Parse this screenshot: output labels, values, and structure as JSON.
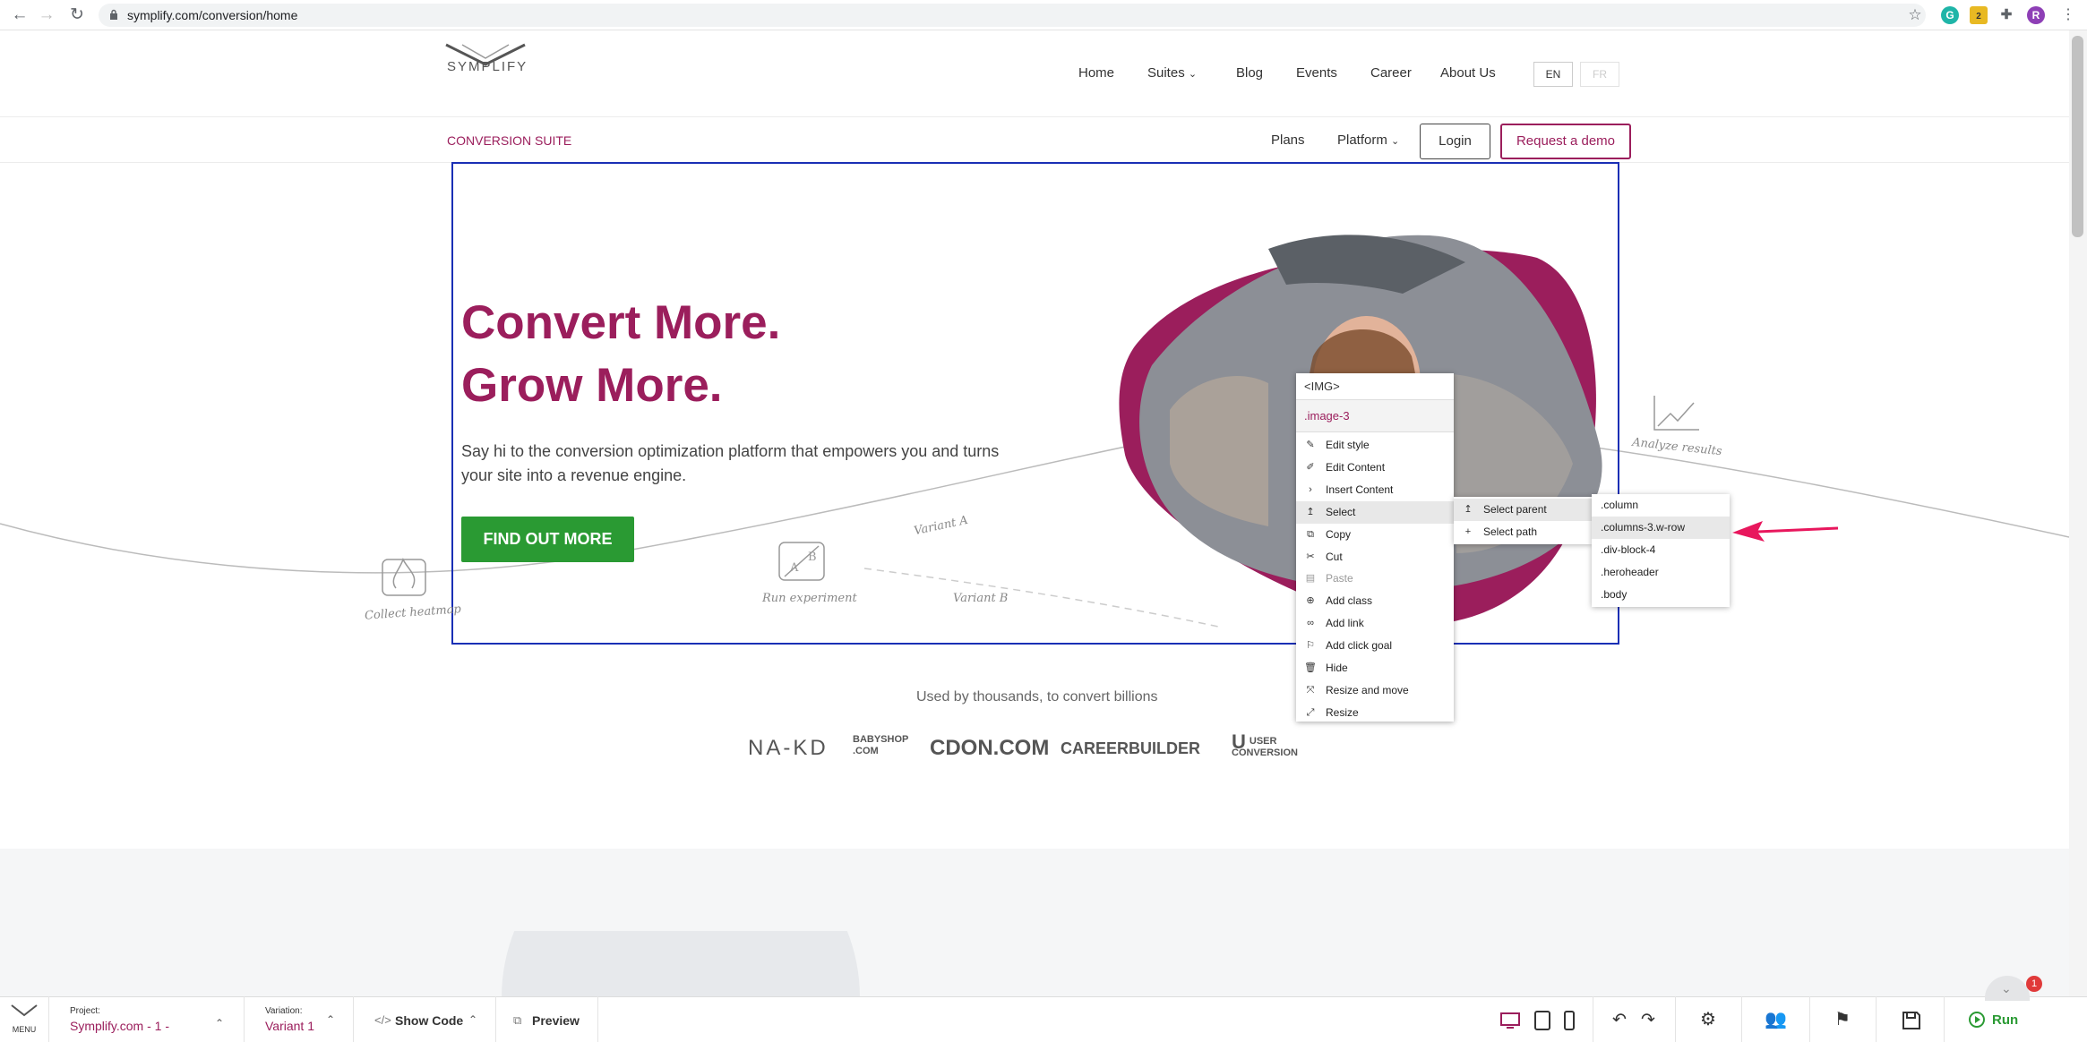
{
  "browser": {
    "url": "symplify.com/conversion/home",
    "avatar_letter": "R",
    "ext_badge": "2"
  },
  "header": {
    "logo": "SYMPLIFY",
    "nav": [
      "Home",
      "Suites",
      "Blog",
      "Events",
      "Career",
      "About Us"
    ],
    "lang_en": "EN",
    "lang_fr": "FR"
  },
  "subheader": {
    "suite": "CONVERSION SUITE",
    "plans": "Plans",
    "platform": "Platform",
    "login": "Login",
    "demo": "Request a demo"
  },
  "hero": {
    "title_line1": "Convert More.",
    "title_line2": "Grow More.",
    "subtitle": "Say hi to the conversion optimization platform that empowers you and turns your site into a revenue engine.",
    "cta": "FIND OUT MORE",
    "sketch_labels": {
      "collect": "Collect heatmap",
      "run": "Run experiment",
      "variant_a": "Variant A",
      "variant_b": "Variant B",
      "analyze": "Analyze results"
    }
  },
  "logos": {
    "heading": "Used by thousands, to convert billions",
    "brands": [
      "NA-KD",
      "BABYSHOP .COM",
      "CDON.COM",
      "CAREERBUILDER",
      "USER CONVERSION"
    ]
  },
  "context_menu": {
    "tag": "<IMG>",
    "class_name": ".image-3",
    "items": [
      "Edit style",
      "Edit Content",
      "Insert Content",
      "Select",
      "Copy",
      "Cut",
      "Paste",
      "Add class",
      "Add link",
      "Add click goal",
      "Hide",
      "Resize and move",
      "Resize"
    ],
    "submenu": [
      "Select parent",
      "Select path"
    ],
    "parents": [
      ".column",
      ".columns-3.w-row",
      ".div-block-4",
      ".heroheader",
      ".body"
    ]
  },
  "toolbar": {
    "menu_label": "MENU",
    "project_label": "Project:",
    "project_value": "Symplify.com - 1 -",
    "variation_label": "Variation:",
    "variation_value": "Variant 1",
    "show_code": "Show Code",
    "preview": "Preview",
    "run": "Run",
    "notification_count": "1"
  },
  "colors": {
    "brand": "#9b1e5c",
    "cta_green": "#2a9a33",
    "selection_frame": "#1a2fb5",
    "arrow": "#e8175d"
  }
}
